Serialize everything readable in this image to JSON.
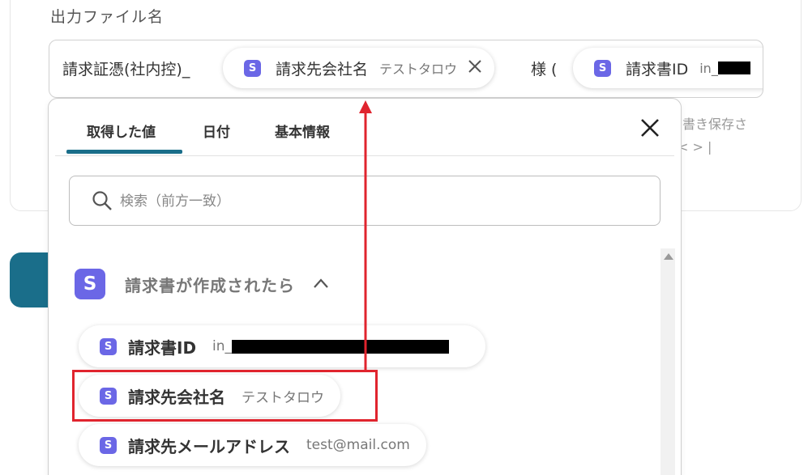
{
  "field": {
    "label": "出力ファイル名"
  },
  "filename": {
    "prefix_text": "請求証憑(社内控)_",
    "chip1": {
      "label": "請求先会社名",
      "value": "テストタロウ"
    },
    "middle_text": "様 (",
    "chip2": {
      "label": "請求書ID",
      "value": "in_"
    }
  },
  "side_hint": {
    "line1": "書き保存さ",
    "line2": "< > |"
  },
  "panel": {
    "tabs": [
      {
        "label": "取得した値"
      },
      {
        "label": "日付"
      },
      {
        "label": "基本情報"
      }
    ],
    "search_placeholder": "検索（前方一致）",
    "section": {
      "title": "請求書が作成されたら",
      "icon_letter": "S"
    },
    "items": [
      {
        "label": "請求書ID",
        "value": "in_"
      },
      {
        "label": "請求先会社名",
        "value": "テストタロウ"
      },
      {
        "label": "請求先メールアドレス",
        "value": "test@mail.com"
      }
    ]
  },
  "badge_letter": "S",
  "colors": {
    "accent": "#1a6e8a",
    "badge": "#6b67e6",
    "highlight": "#e0242e"
  }
}
